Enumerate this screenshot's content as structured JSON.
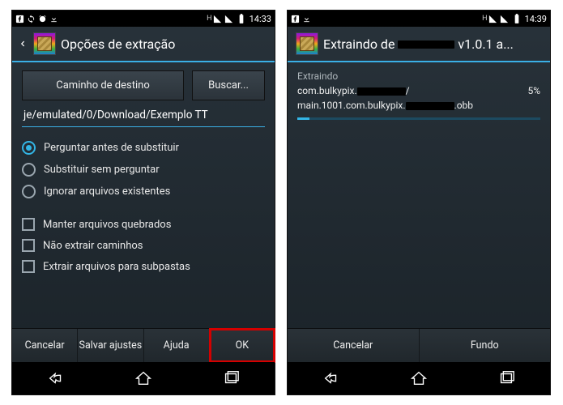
{
  "left": {
    "statusbar": {
      "time": "14:33",
      "net_letter": "H"
    },
    "appbar": {
      "title": "Opções de extração"
    },
    "top": {
      "path_label": "Caminho de destino",
      "browse": "Buscar..."
    },
    "path_value": "je/emulated/0/Download/Exemplo TT",
    "radios": {
      "ask": "Perguntar antes de substituir",
      "overwrite": "Substituir sem perguntar",
      "skip": "Ignorar arquivos existentes"
    },
    "checks": {
      "broken": "Manter arquivos quebrados",
      "nopaths": "Não extrair caminhos",
      "subfolders": "Extrair arquivos para subpastas"
    },
    "bottom": {
      "cancel": "Cancelar",
      "save": "Salvar ajustes",
      "help": "Ajuda",
      "ok": "OK"
    }
  },
  "right": {
    "statusbar": {
      "time": "14:39",
      "net_letter": "H"
    },
    "appbar": {
      "title_prefix": "Extraindo de ",
      "title_suffix": " v1.0.1 a..."
    },
    "extract": {
      "heading": "Extraindo",
      "line1_prefix": "com.bulkypix.",
      "line1_suffix": "/",
      "line2_prefix": "main.1001.com.bulkypix.",
      "line2_suffix": ".obb",
      "percent": "5%",
      "progress_pct": 5
    },
    "bottom": {
      "cancel": "Cancelar",
      "background": "Fundo"
    }
  }
}
